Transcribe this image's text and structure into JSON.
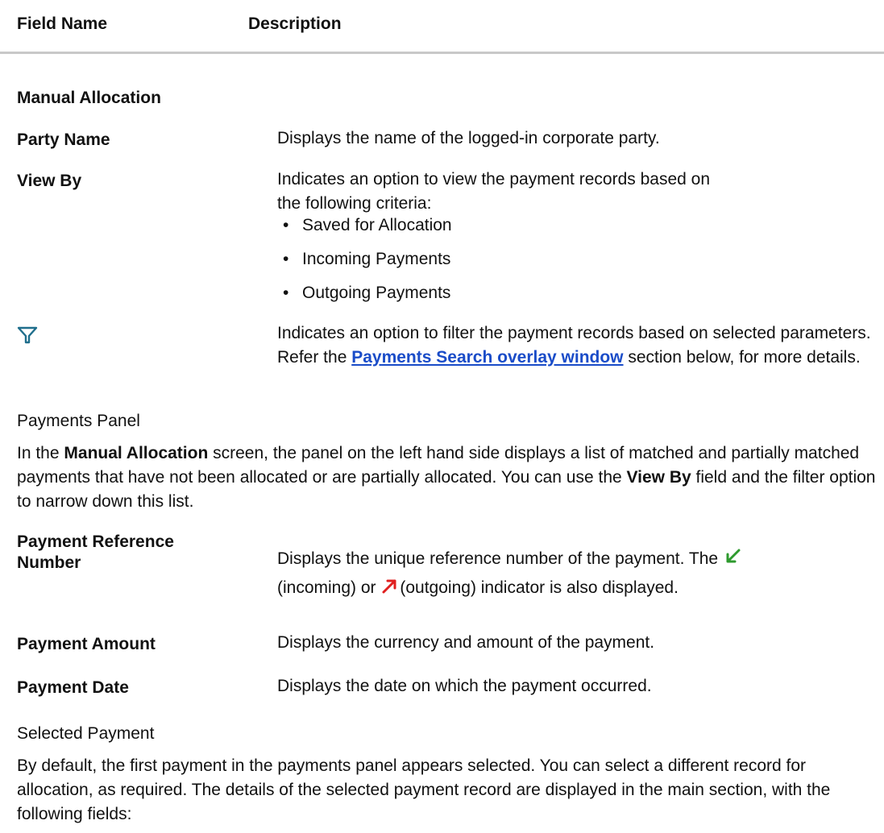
{
  "header": {
    "col1": "Field Name",
    "col2": "Description"
  },
  "section_title": "Manual Allocation",
  "rows1": {
    "party_name": {
      "label": "Party Name",
      "desc": "Displays the name of the logged-in corporate party."
    },
    "view_by": {
      "label": "View By",
      "desc": "Indicates an option to view the payment records based on the following criteria:",
      "options": [
        "Saved for Allocation",
        "Incoming Payments",
        "Outgoing Payments"
      ]
    },
    "filter": {
      "icon": "filter-icon",
      "desc_before": "Indicates an option to filter the payment records based on selected parameters. Refer the ",
      "link": "Payments Search overlay window",
      "desc_after": " section below, for more details."
    }
  },
  "payments_panel": {
    "title": "Payments Panel",
    "p1": "In the ",
    "p_bold1": "Manual Allocation",
    "p2": " screen, the panel on the left hand side displays a list of matched and partially matched payments that have not been allocated or are partially allocated. You can use the ",
    "p_bold2": "View By",
    "p3": " field and the filter option to narrow down this list."
  },
  "rows2": {
    "ref": {
      "label": "Payment Reference Number",
      "desc1": "Displays the unique reference number of the payment. The ",
      "incoming": "(incoming) or ",
      "outgoing": "(outgoing) indicator is also displayed."
    },
    "amount": {
      "label": "Payment Amount",
      "desc": "Displays the currency and amount of the payment."
    },
    "date": {
      "label": "Payment Date",
      "desc": "Displays the date on which the payment occurred."
    }
  },
  "selected_payment": {
    "title": "Selected Payment",
    "desc": "By default, the first payment in the payments panel appears selected. You can select a different record for allocation, as required. The details of the selected payment record are displayed in the main section, with the following fields:"
  },
  "colors": {
    "link": "#1a4cc8",
    "filter_icon": "#1f6e8c",
    "incoming_icon": "#2e9a2e",
    "outgoing_icon": "#e02020"
  }
}
